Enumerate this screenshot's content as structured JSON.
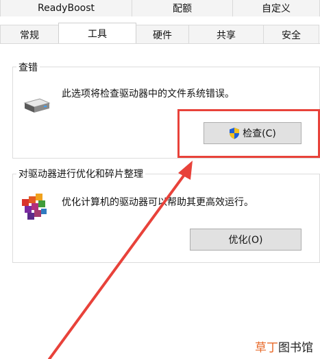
{
  "tabs_row1": [
    "ReadyBoost",
    "配额",
    "自定义"
  ],
  "tabs_row2": [
    "常规",
    "工具",
    "硬件",
    "共享",
    "安全"
  ],
  "active_tab": "工具",
  "error_check": {
    "title": "查错",
    "description": "此选项将检查驱动器中的文件系统错误。",
    "button_label": "检查(C)"
  },
  "optimize": {
    "title": "对驱动器进行优化和碎片整理",
    "description": "优化计算机的驱动器可以帮助其更高效运行。",
    "button_label": "优化(O)"
  },
  "watermark": {
    "part1": "草丁",
    "part2": "图书馆"
  },
  "annotation_color": "#e8423a"
}
